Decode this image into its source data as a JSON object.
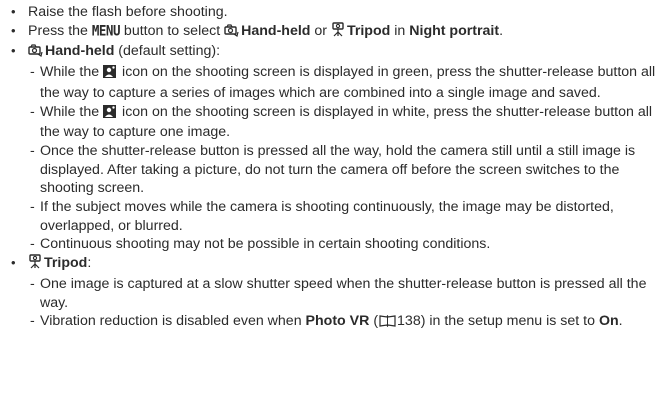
{
  "items": {
    "raise_flash": "Raise the flash before shooting.",
    "press_menu": {
      "pre": "Press the ",
      "menu_word": "MENU",
      "mid1": " button to select ",
      "handheld": "Hand-held",
      "or": " or ",
      "tripod": "Tripod",
      "in": " in ",
      "night_portrait": "Night portrait",
      "end": "."
    },
    "handheld_head": {
      "label": "Hand-held",
      "rest": " (default setting):"
    },
    "handheld_subs": {
      "s1": {
        "pre": "While the ",
        "post": " icon on the shooting screen is displayed in green, press the shutter-release button all the way to capture a series of images which are combined into a single image and saved."
      },
      "s2": {
        "pre": "While the ",
        "post": " icon on the shooting screen is displayed in white, press the shutter-release button all the way to capture one image."
      },
      "s3": "Once the shutter-release button is pressed all the way, hold the camera still until a still image is displayed. After taking a picture, do not turn the camera off before the screen switches to the shooting screen.",
      "s4": "If the subject moves while the camera is shooting continuously, the image may be distorted, overlapped, or blurred.",
      "s5": "Continuous shooting may not be possible in certain shooting conditions."
    },
    "tripod_head": {
      "label": "Tripod",
      "rest": ":"
    },
    "tripod_subs": {
      "t1": "One image is captured at a slow shutter speed when the shutter-release button is pressed all the way.",
      "t2": {
        "pre": "Vibration reduction is disabled even when ",
        "photo_vr": "Photo VR",
        "paren_open": " (",
        "page": "138",
        "paren_close": ") in the setup menu is set to ",
        "on": "On",
        "end": "."
      }
    }
  },
  "icons": {
    "bullet": "bullet-dot",
    "handheld": "handheld-icon",
    "tripod": "tripod-icon",
    "night_portrait_scene": "night-portrait-icon",
    "book_reference": "book-icon"
  },
  "colors": {
    "text": "#2b2b2b",
    "background": "#ffffff"
  }
}
